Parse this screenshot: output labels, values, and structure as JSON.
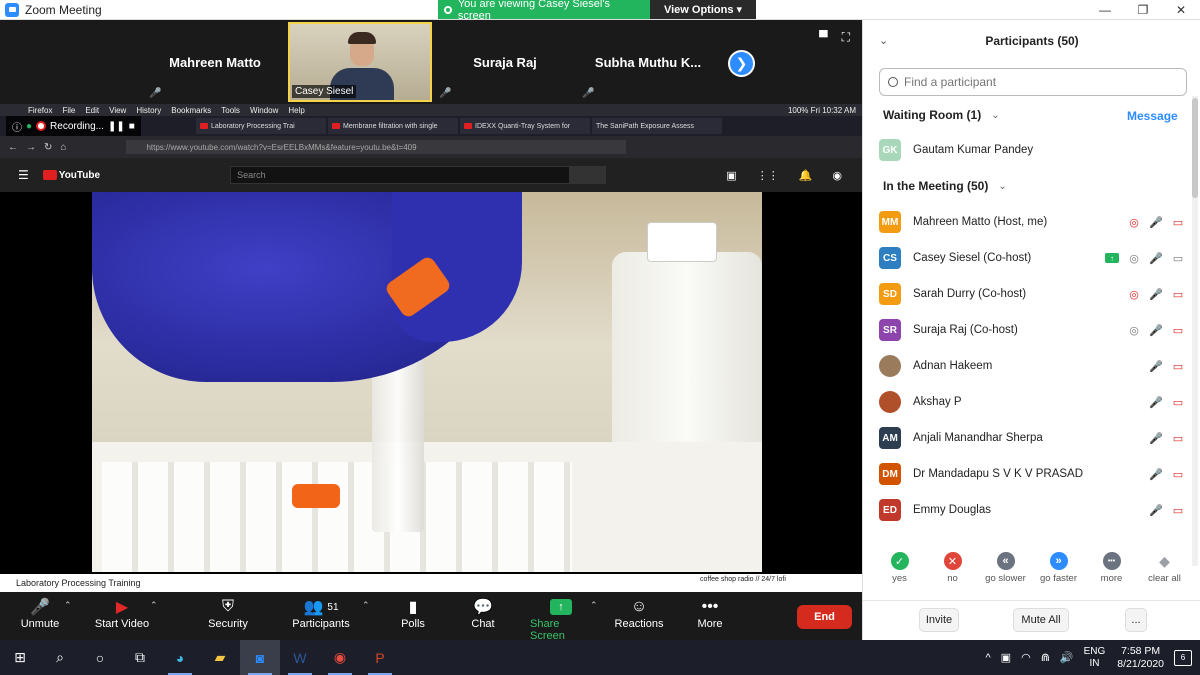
{
  "window": {
    "title": "Zoom Meeting",
    "min": "—",
    "max": "❐",
    "close": "✕"
  },
  "share_banner": {
    "message": "You are viewing Casey Siesel's screen",
    "options": "View Options ▾"
  },
  "gallery": {
    "tiles": [
      {
        "name": "Mahreen Matto"
      },
      {
        "name": "Casey Siesel"
      },
      {
        "name": "Suraja Raj"
      },
      {
        "name": "Subha Muthu K..."
      }
    ],
    "next_glyph": "❯"
  },
  "shared_screen": {
    "recording_label": "Recording...",
    "menubar": [
      "Firefox",
      "File",
      "Edit",
      "View",
      "History",
      "Bookmarks",
      "Tools",
      "Window",
      "Help"
    ],
    "menubar_right": "100%  Fri 10:32 AM",
    "tabs": [
      "Laboratory Processing Trai",
      "Membrane filtration with single",
      "IDEXX Quanti-Tray System for",
      "The SaniPath Exposure Assess"
    ],
    "url": "https://www.youtube.com/watch?v=EsrEELBxMMs&feature=youtu.be&t=409",
    "youtube_logo": "YouTube",
    "yt_search_placeholder": "Search",
    "video_title": "Laboratory Processing Training",
    "side_video": "coffee shop radio // 24/7 lofi"
  },
  "toolbar": {
    "unmute": "Unmute",
    "start_video": "Start Video",
    "security": "Security",
    "participants": "Participants",
    "participants_count": "51",
    "polls": "Polls",
    "chat": "Chat",
    "share_screen": "Share Screen",
    "reactions": "Reactions",
    "more": "More",
    "end": "End"
  },
  "panel": {
    "title": "Participants (50)",
    "search_placeholder": "Find a participant",
    "waiting_room": "Waiting Room (1)",
    "message_link": "Message",
    "in_meeting": "In the Meeting (50)",
    "waiting": [
      {
        "initials": "GK",
        "name": "Gautam Kumar Pandey",
        "color": "#a8d8b9"
      }
    ],
    "participants": [
      {
        "initials": "MM",
        "name": "Mahreen Matto (Host, me)",
        "color": "#f39c12"
      },
      {
        "initials": "CS",
        "name": "Casey Siesel (Co-host)",
        "color": "#2d7fc1"
      },
      {
        "initials": "SD",
        "name": "Sarah Durry (Co-host)",
        "color": "#f39c12"
      },
      {
        "initials": "SR",
        "name": "Suraja Raj (Co-host)",
        "color": "#8e44ad"
      },
      {
        "initials": "",
        "name": "Adnan Hakeem",
        "color": "#9a7b5c"
      },
      {
        "initials": "",
        "name": "Akshay P",
        "color": "#b0502a"
      },
      {
        "initials": "AM",
        "name": "Anjali Manandhar Sherpa",
        "color": "#2c3e50"
      },
      {
        "initials": "DM",
        "name": "Dr Mandadapu S V K V PRASAD",
        "color": "#d35400"
      },
      {
        "initials": "ED",
        "name": "Emmy Douglas",
        "color": "#c0392b"
      }
    ],
    "reactions": [
      {
        "label": "yes",
        "glyph": "✓",
        "color": "#23b45e"
      },
      {
        "label": "no",
        "glyph": "✕",
        "color": "#e0453a"
      },
      {
        "label": "go slower",
        "glyph": "«",
        "color": "#6b7280"
      },
      {
        "label": "go faster",
        "glyph": "»",
        "color": "#2d8cff"
      },
      {
        "label": "more",
        "glyph": "•••",
        "color": "#6b7280"
      },
      {
        "label": "clear all",
        "glyph": "◆",
        "color": "#9aa0a6"
      }
    ],
    "invite": "Invite",
    "mute_all": "Mute All",
    "more": "..."
  },
  "taskbar": {
    "lang_top": "ENG",
    "lang_bottom": "IN",
    "time": "7:58 PM",
    "date": "8/21/2020",
    "notifications": "6"
  }
}
